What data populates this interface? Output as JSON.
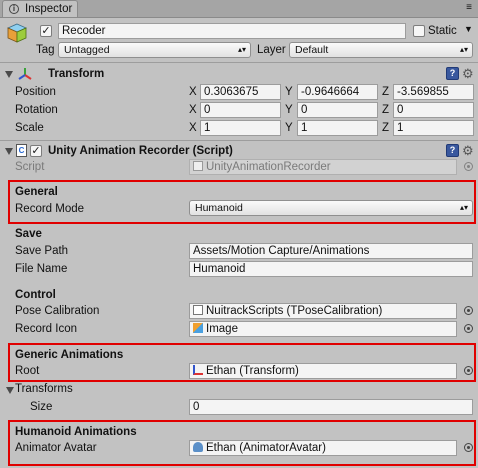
{
  "window": {
    "tab_label": "Inspector",
    "tab_icon": "info-icon"
  },
  "header": {
    "object_name": "Recoder",
    "active_checked": true,
    "static_label": "Static",
    "static_checked": false,
    "tag_label": "Tag",
    "tag_value": "Untagged",
    "layer_label": "Layer",
    "layer_value": "Default"
  },
  "transform": {
    "title": "Transform",
    "position_label": "Position",
    "rotation_label": "Rotation",
    "scale_label": "Scale",
    "axis_x": "X",
    "axis_y": "Y",
    "axis_z": "Z",
    "position": {
      "x": "0.3063675",
      "y": "-0.9646664",
      "z": "-3.569855"
    },
    "rotation": {
      "x": "0",
      "y": "0",
      "z": "0"
    },
    "scale": {
      "x": "1",
      "y": "1",
      "z": "1"
    }
  },
  "script_component": {
    "title": "Unity Animation Recorder (Script)",
    "enabled": true,
    "script_label": "Script",
    "script_value": "UnityAnimationRecorder"
  },
  "general": {
    "header": "General",
    "record_mode_label": "Record Mode",
    "record_mode_value": "Humanoid"
  },
  "save": {
    "header": "Save",
    "save_path_label": "Save Path",
    "save_path_value": "Assets/Motion Capture/Animations",
    "file_name_label": "File Name",
    "file_name_value": "Humanoid"
  },
  "control": {
    "header": "Control",
    "pose_calibration_label": "Pose Calibration",
    "pose_calibration_value": "NuitrackScripts (TPoseCalibration)",
    "record_icon_label": "Record Icon",
    "record_icon_value": "Image"
  },
  "generic_animations": {
    "header": "Generic Animations",
    "root_label": "Root",
    "root_value": "Ethan (Transform)",
    "transforms_label": "Transforms",
    "size_label": "Size",
    "size_value": "0"
  },
  "humanoid_animations": {
    "header": "Humanoid Animations",
    "animator_avatar_label": "Animator Avatar",
    "animator_avatar_value": "Ethan (AnimatorAvatar)"
  },
  "colors": {
    "highlight_box": "#e00000",
    "panel_background": "#c2c2c2",
    "help_icon": "#39589e"
  }
}
